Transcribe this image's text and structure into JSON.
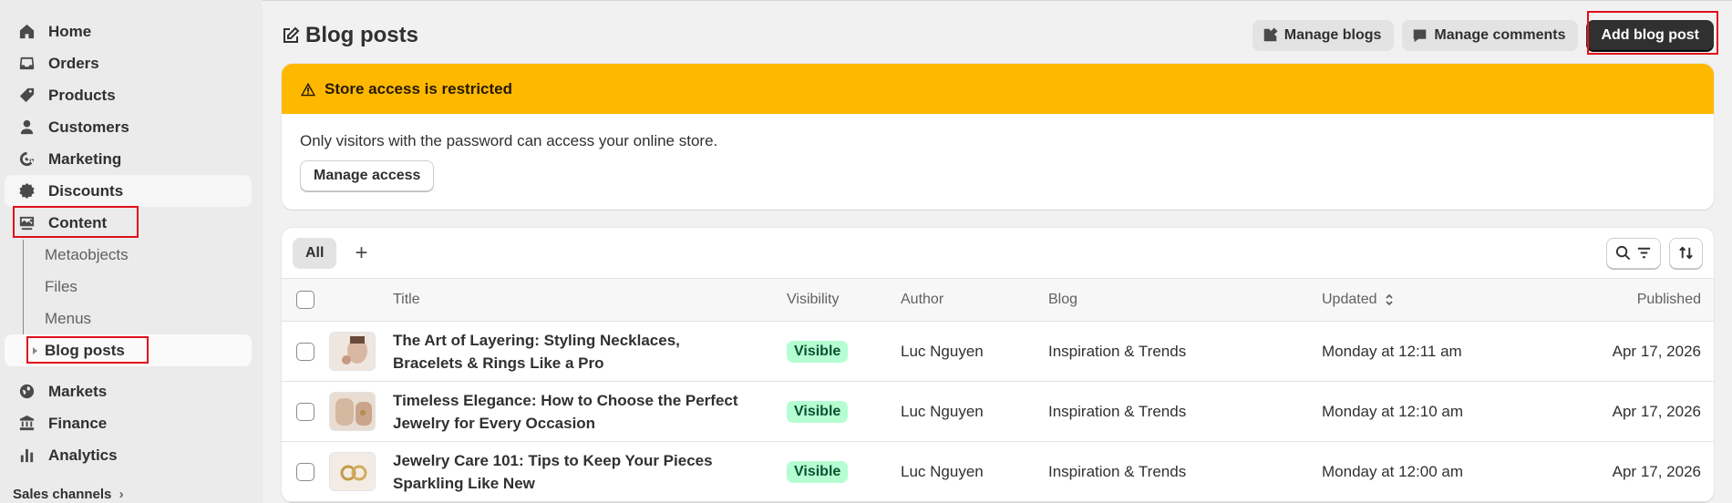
{
  "sidebar": {
    "nav": [
      {
        "label": "Home",
        "icon": "home-icon"
      },
      {
        "label": "Orders",
        "icon": "inbox-icon"
      },
      {
        "label": "Products",
        "icon": "tag-icon"
      },
      {
        "label": "Customers",
        "icon": "person-icon"
      },
      {
        "label": "Marketing",
        "icon": "target-icon"
      },
      {
        "label": "Discounts",
        "icon": "discount-icon"
      },
      {
        "label": "Content",
        "icon": "content-icon"
      }
    ],
    "content_sub": [
      "Metaobjects",
      "Files",
      "Menus",
      "Blog posts"
    ],
    "nav2": [
      {
        "label": "Markets",
        "icon": "globe-icon"
      },
      {
        "label": "Finance",
        "icon": "bank-icon"
      },
      {
        "label": "Analytics",
        "icon": "chart-icon"
      }
    ],
    "sales_channels": "Sales channels",
    "sales_channels_chevron": "›"
  },
  "header": {
    "title": "Blog posts",
    "manage_blogs": "Manage blogs",
    "manage_comments": "Manage comments",
    "add_blog_post": "Add blog post"
  },
  "banner": {
    "title": "Store access is restricted",
    "text": "Only visitors with the password can access your online store.",
    "button": "Manage access",
    "color": "#ffb800"
  },
  "table": {
    "tab_all": "All",
    "tab_add": "+",
    "columns": {
      "title": "Title",
      "visibility": "Visibility",
      "author": "Author",
      "blog": "Blog",
      "updated": "Updated",
      "published": "Published"
    },
    "rows": [
      {
        "title": "The Art of Layering: Styling Necklaces, Bracelets & Rings Like a Pro",
        "visibility": "Visible",
        "author": "Luc Nguyen",
        "blog": "Inspiration & Trends",
        "updated": "Monday at 12:11 am",
        "published": "Apr 17, 2026"
      },
      {
        "title": "Timeless Elegance: How to Choose the Perfect Jewelry for Every Occasion",
        "visibility": "Visible",
        "author": "Luc Nguyen",
        "blog": "Inspiration & Trends",
        "updated": "Monday at 12:10 am",
        "published": "Apr 17, 2026"
      },
      {
        "title": "Jewelry Care 101: Tips to Keep Your Pieces Sparkling Like New",
        "visibility": "Visible",
        "author": "Luc Nguyen",
        "blog": "Inspiration & Trends",
        "updated": "Monday at 12:00 am",
        "published": "Apr 17, 2026"
      }
    ]
  }
}
